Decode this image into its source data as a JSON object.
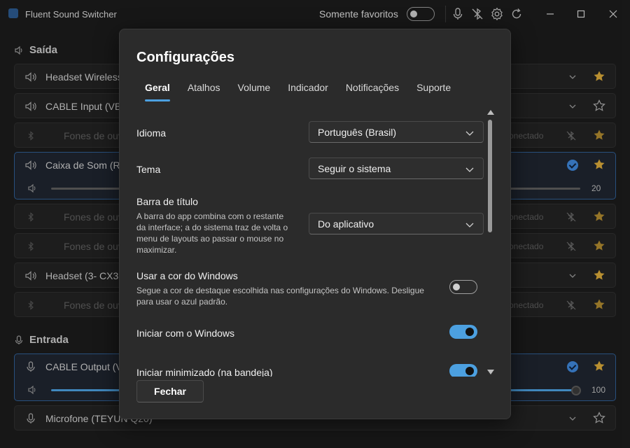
{
  "app": {
    "title": "Fluent Sound Switcher",
    "favorites_label": "Somente favoritos",
    "favorites_only": false
  },
  "sections": {
    "output_title": "Saída",
    "input_title": "Entrada"
  },
  "devices": {
    "output": [
      {
        "name": "Headset Wireless",
        "starred": true,
        "state": "normal"
      },
      {
        "name": "CABLE Input (VB-",
        "starred": false,
        "state": "normal"
      },
      {
        "name": "Fones de ouv",
        "starred": true,
        "state": "disconnected",
        "status": "conectado"
      },
      {
        "name": "Caixa de Som (Re",
        "starred": true,
        "state": "selected",
        "volume": "20"
      },
      {
        "name": "Fones de ouv",
        "starred": true,
        "state": "disconnected",
        "status": "conectado"
      },
      {
        "name": "Fones de ouv",
        "starred": true,
        "state": "disconnected",
        "status": "conectado"
      },
      {
        "name": "Headset (3- CX31",
        "starred": true,
        "state": "normal"
      },
      {
        "name": "Fones de ouv",
        "starred": true,
        "state": "disconnected",
        "status": "conectado"
      }
    ],
    "input": [
      {
        "name": "CABLE Output (V",
        "starred": true,
        "state": "selected",
        "volume": "100"
      },
      {
        "name": "Microfone (TEYUN Q20)",
        "starred": false,
        "state": "normal"
      }
    ]
  },
  "dialog": {
    "title": "Configurações",
    "tabs": [
      "Geral",
      "Atalhos",
      "Volume",
      "Indicador",
      "Notificações",
      "Suporte"
    ],
    "active_tab": "Geral",
    "settings": {
      "language": {
        "label": "Idioma",
        "value": "Português (Brasil)"
      },
      "theme": {
        "label": "Tema",
        "value": "Seguir o sistema"
      },
      "titlebar": {
        "label": "Barra de título",
        "description_lines": [
          "A barra do app combina com o restante",
          "da interface; a do sistema traz de volta o",
          "menu de layouts ao passar o mouse no",
          "maximizar."
        ],
        "value": "Do aplicativo"
      },
      "windows_color": {
        "label": "Usar a cor do Windows",
        "description_lines": [
          "Segue a cor de destaque escolhida nas configurações do Windows. Desligue",
          "para usar o azul padrão."
        ],
        "enabled": false
      },
      "start_with_windows": {
        "label": "Iniciar com o Windows",
        "enabled": true
      },
      "start_minimized": {
        "label": "Iniciar minimizado (na bandeja)",
        "enabled": true
      }
    },
    "close_label": "Fechar"
  },
  "colors": {
    "accent": "#4ca0e0",
    "star": "#d9a93a",
    "background": "#1c1c1c",
    "dialog": "#2b2b2b"
  }
}
